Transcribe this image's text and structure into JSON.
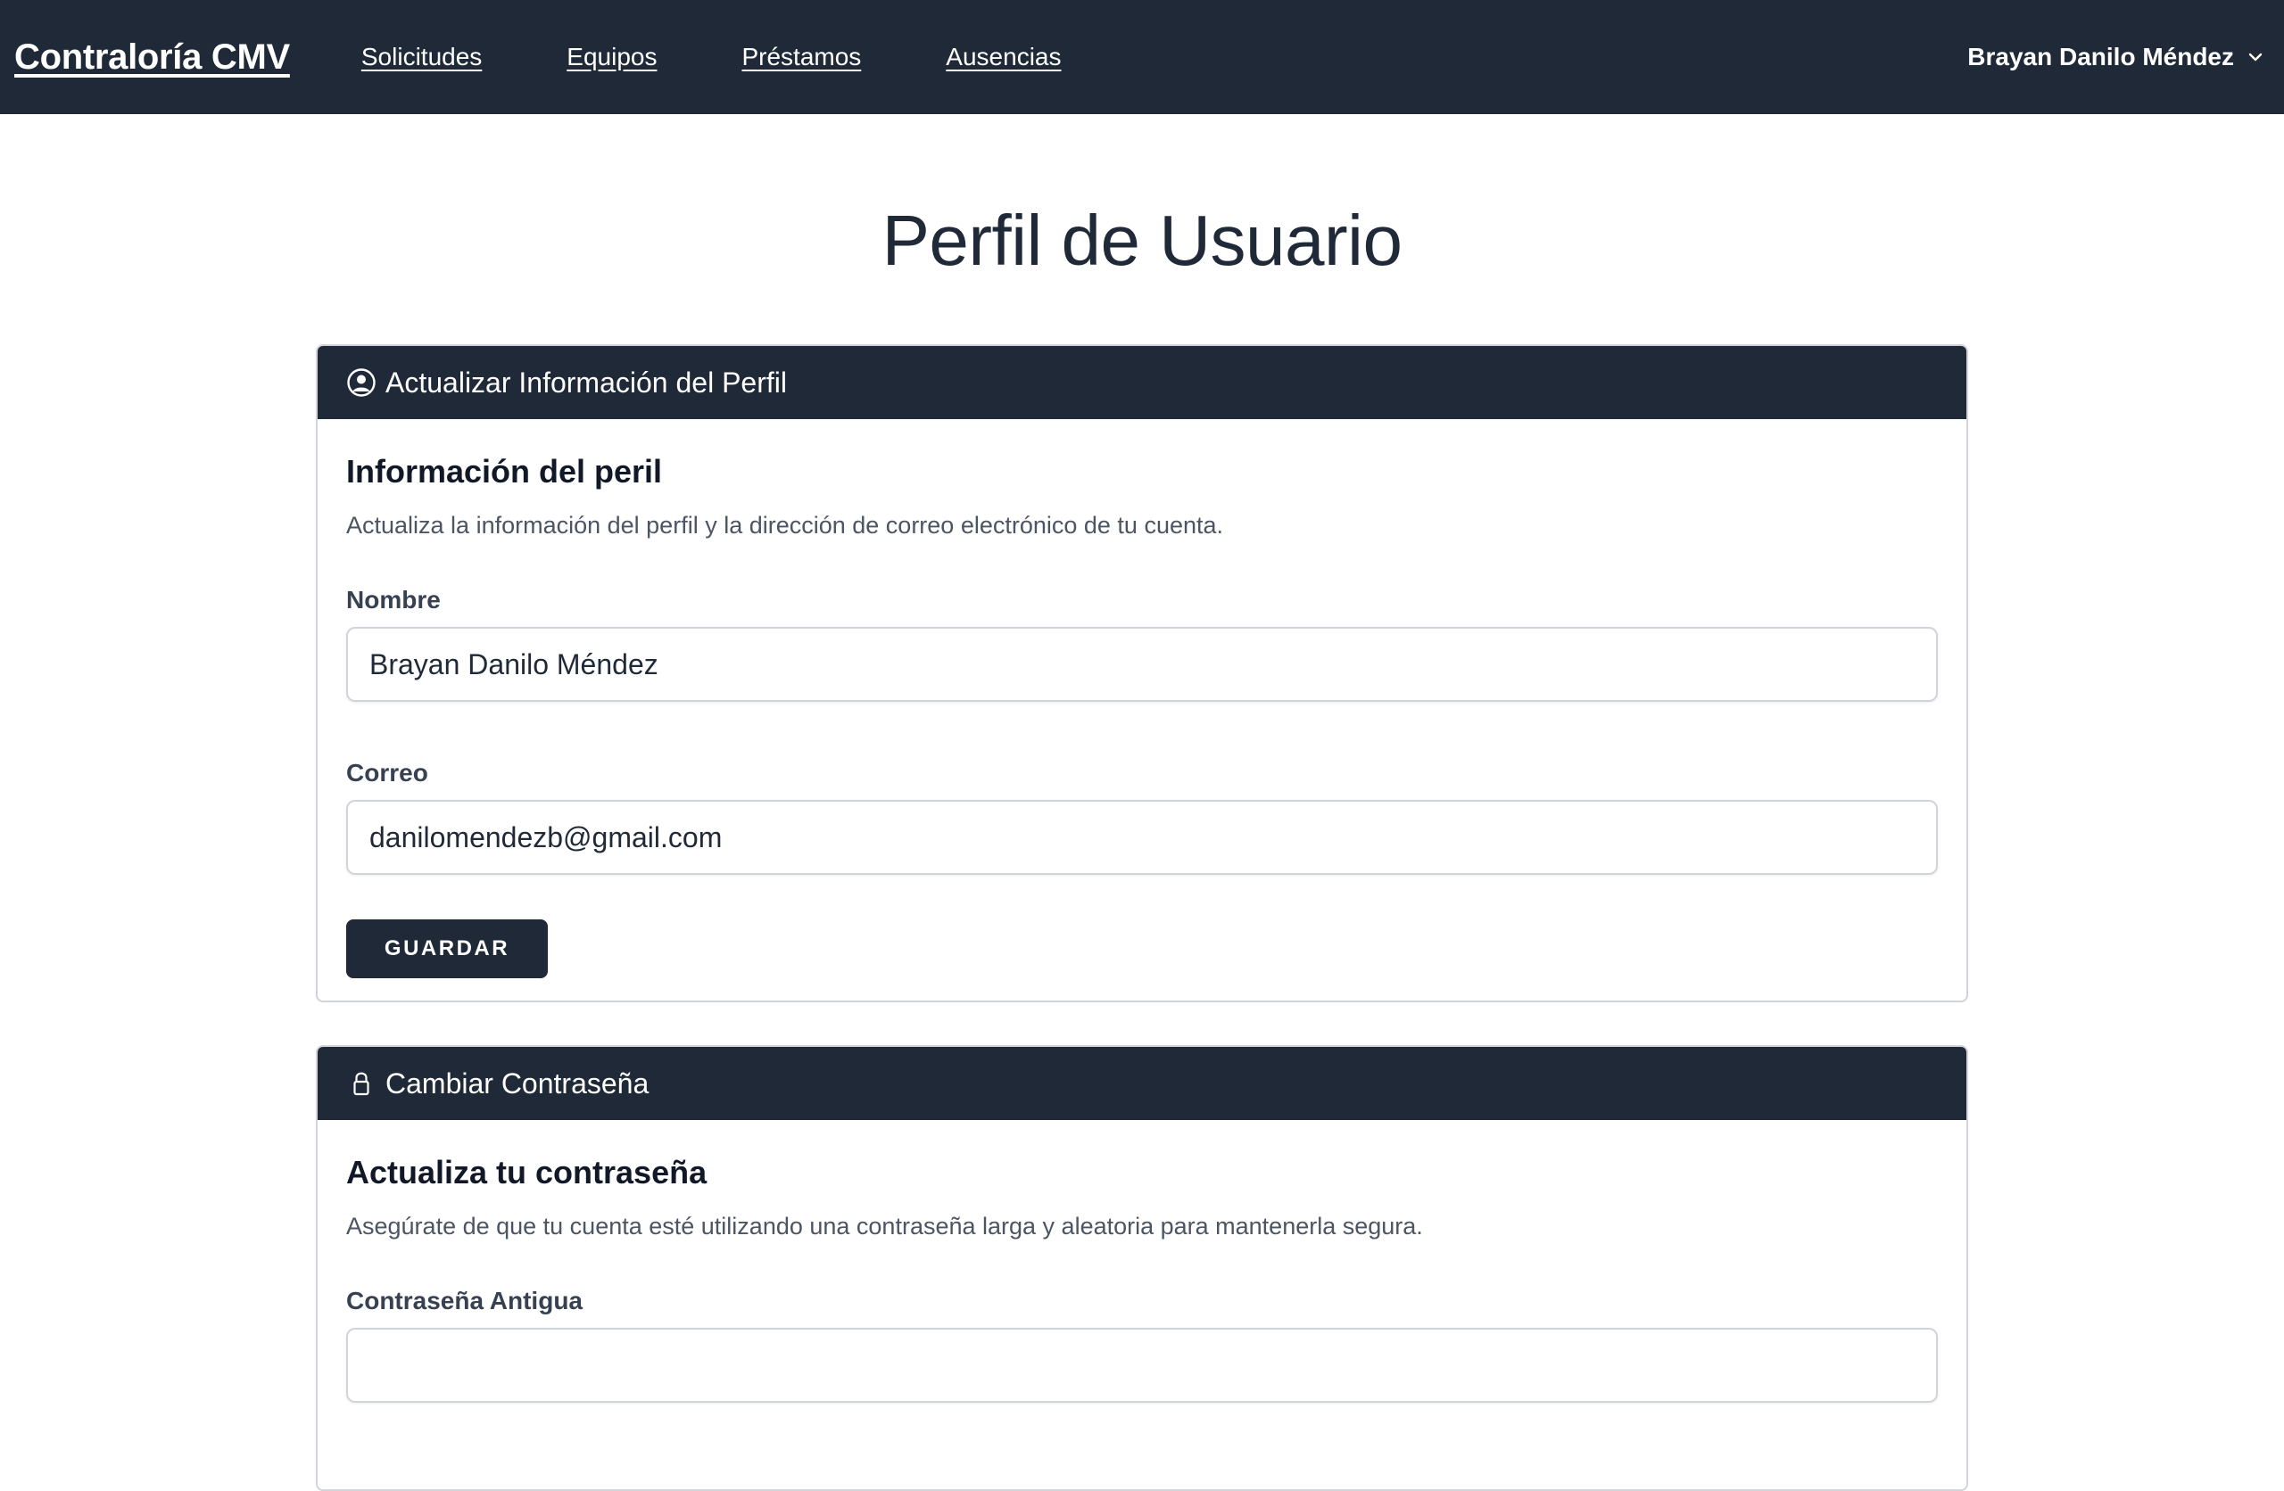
{
  "nav": {
    "brand": "Contraloría CMV",
    "links": [
      "Solicitudes",
      "Equipos",
      "Préstamos",
      "Ausencias"
    ],
    "user_name": "Brayan Danilo Méndez"
  },
  "page": {
    "title": "Perfil de Usuario"
  },
  "profile_card": {
    "header": "Actualizar Información del Perfil",
    "section_title": "Información del peril",
    "description": "Actualiza la información del perfil y la dirección de correo electrónico de tu cuenta.",
    "name_label": "Nombre",
    "name_value": "Brayan Danilo Méndez",
    "email_label": "Correo",
    "email_value": "danilomendezb@gmail.com",
    "save_label": "GUARDAR"
  },
  "password_card": {
    "header": "Cambiar Contraseña",
    "section_title": "Actualiza tu contraseña",
    "description": "Asegúrate de que tu cuenta esté utilizando una contraseña larga y aleatoria para mantenerla segura.",
    "old_password_label": "Contraseña Antigua",
    "old_password_value": ""
  },
  "icons": {
    "profile_header": "user-circle-icon",
    "password_header": "lock-icon",
    "user_menu": "chevron-down-icon"
  },
  "colors": {
    "navbar_bg": "#1f2937",
    "card_header_bg": "#1f2937",
    "button_bg": "#1f2937"
  }
}
